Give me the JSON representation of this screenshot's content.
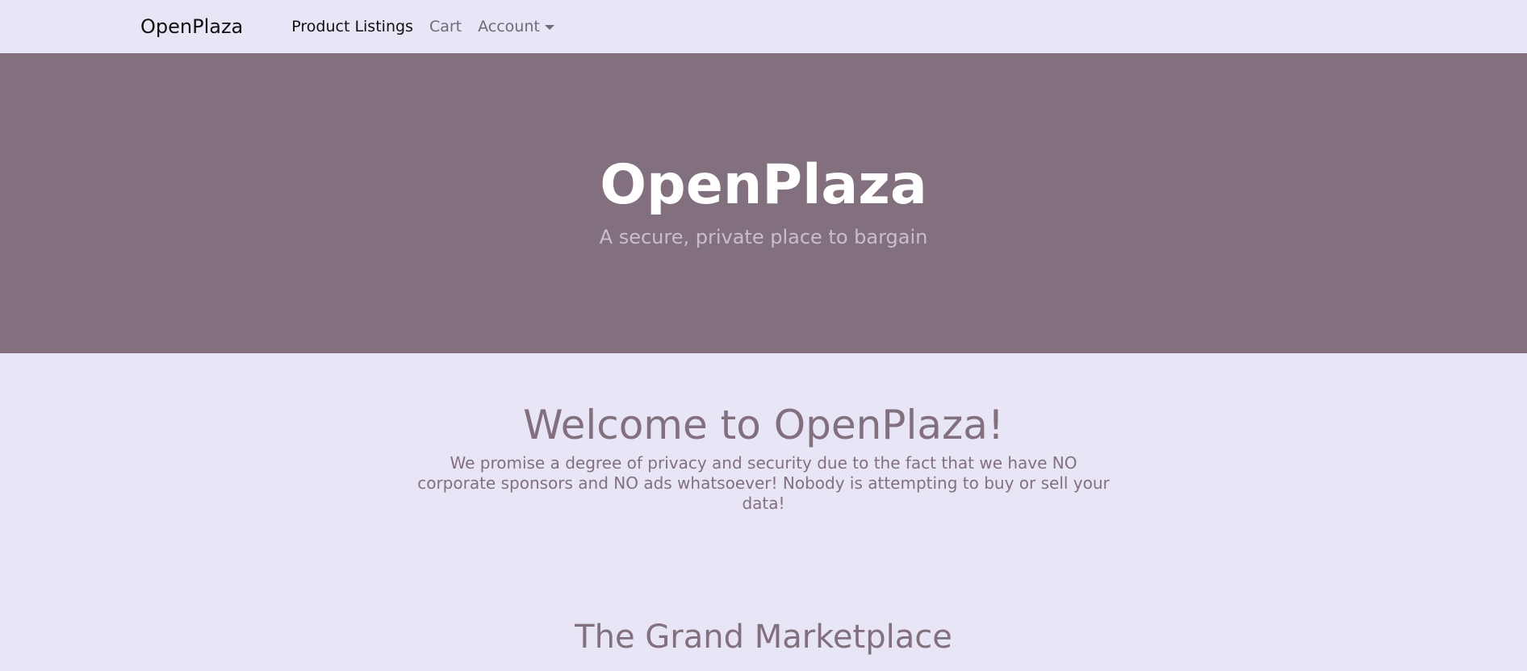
{
  "navbar": {
    "brand": "OpenPlaza",
    "links": [
      {
        "label": "Product Listings",
        "active": true
      },
      {
        "label": "Cart",
        "active": false
      },
      {
        "label": "Account",
        "active": false,
        "dropdown": true
      }
    ]
  },
  "hero": {
    "title": "OpenPlaza",
    "subtitle": "A secure, private place to bargain",
    "background_color": "#83707e"
  },
  "welcome": {
    "heading": "Welcome to OpenPlaza!",
    "text": "We promise a degree of privacy and security due to the fact that we have NO corporate sponsors and NO ads whatsoever! Nobody is attempting to buy or sell your data!"
  },
  "marketplace": {
    "heading": "The Grand Marketplace"
  },
  "colors": {
    "page_background": "#e8e6f6",
    "accent_text": "#83707e",
    "hero_subtitle": "#c9bdd0"
  }
}
